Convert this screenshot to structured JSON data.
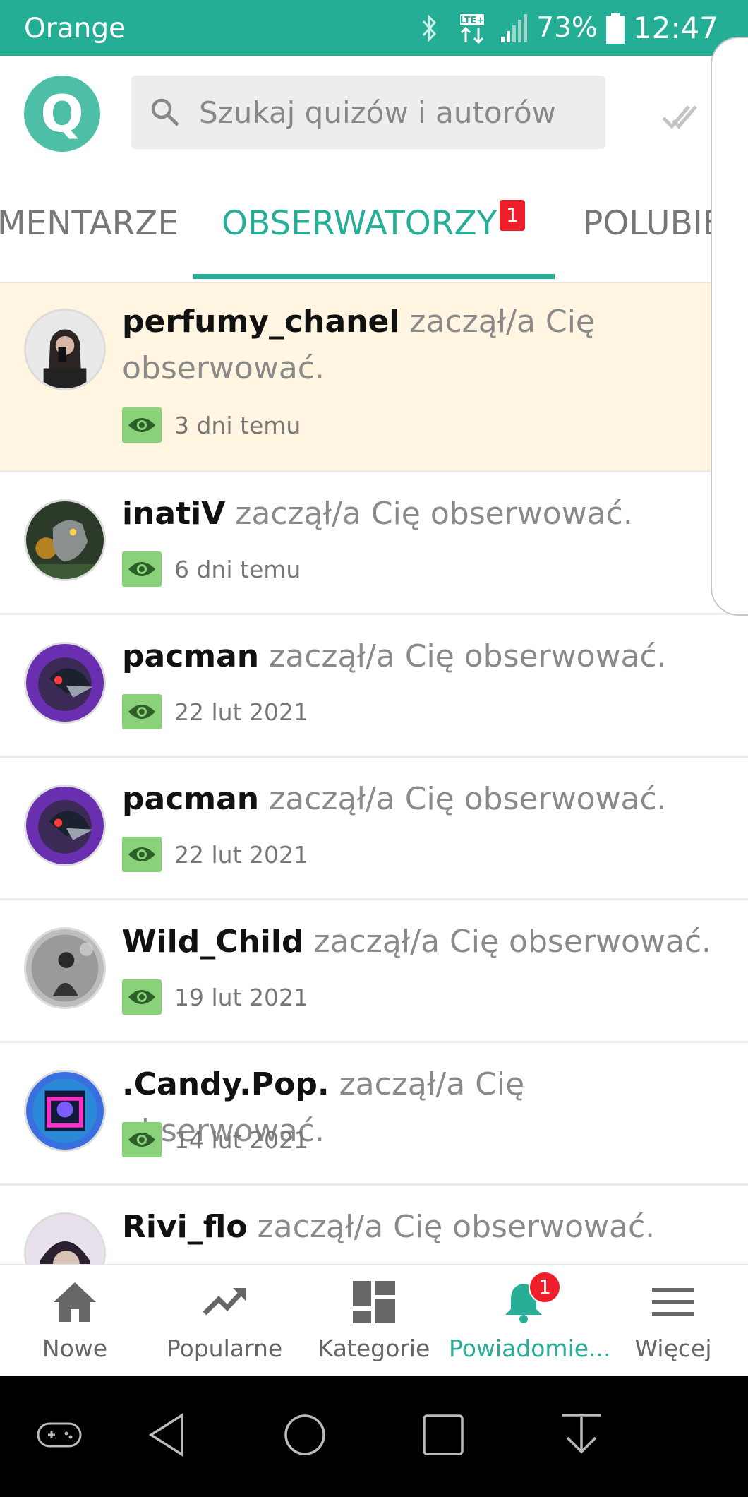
{
  "status_bar": {
    "carrier": "Orange",
    "network": "LTE+",
    "battery": "73%",
    "time": "12:47"
  },
  "header": {
    "logo_letter": "Q",
    "search_placeholder": "Szukaj quizów i autorów"
  },
  "tabs": {
    "items": [
      {
        "label": "MENTARZE"
      },
      {
        "label": "OBSERWATORZY",
        "badge": "1",
        "active": true
      },
      {
        "label": "POLUBIE"
      }
    ]
  },
  "notifications": [
    {
      "user": "perfumy_chanel",
      "action": "zaczął/a Cię obserwować.",
      "time": "3 dni temu",
      "highlighted": true
    },
    {
      "user": "inatiV",
      "action": "zaczął/a Cię obserwować.",
      "time": "6 dni temu"
    },
    {
      "user": "pacman",
      "action": "zaczął/a Cię obserwować.",
      "time": "22 lut 2021"
    },
    {
      "user": "pacman",
      "action": "zaczął/a Cię obserwować.",
      "time": "22 lut 2021"
    },
    {
      "user": "Wild_Child",
      "action": "zaczął/a Cię obserwować.",
      "time": "19 lut 2021"
    },
    {
      "user": ".Candy.Pop.",
      "action": "zaczął/a Cię obserwować.",
      "time": "14 lut 2021"
    },
    {
      "user": "Rivi_flo",
      "action": "zaczął/a Cię obserwować.",
      "time": ""
    }
  ],
  "bottom_nav": {
    "items": [
      {
        "label": "Nowe",
        "icon": "home-icon"
      },
      {
        "label": "Popularne",
        "icon": "trending-icon"
      },
      {
        "label": "Kategorie",
        "icon": "dashboard-icon"
      },
      {
        "label": "Powiadomie...",
        "icon": "bell-icon",
        "badge": "1",
        "active": true
      },
      {
        "label": "Więcej",
        "icon": "menu-icon"
      }
    ]
  },
  "colors": {
    "brand": "#25ae96",
    "highlight_row": "#fff5e0",
    "badge": "#ee1e2a",
    "eye_badge": "#8ad27a"
  }
}
